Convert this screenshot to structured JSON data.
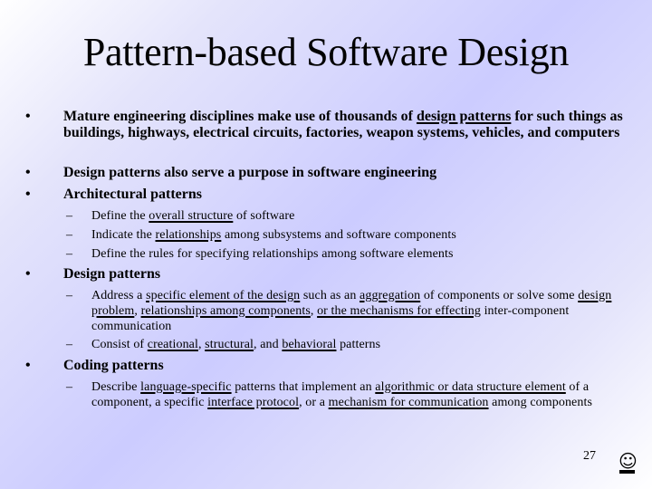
{
  "slide": {
    "title": "Pattern-based Software Design",
    "page_number": "27",
    "footer_icon": "smiley-face-icon",
    "colors": {
      "background_mid": "#ccccff",
      "background_edge": "#ffffff",
      "text": "#000000"
    }
  },
  "bullets": [
    {
      "marker": "•",
      "parts": [
        {
          "text": "Mature engineering disciplines make use of thousands of "
        },
        {
          "text": "design patterns",
          "underline": true
        },
        {
          "text": " for such things as buildings, highways, electrical circuits, factories, weapon systems, vehicles, and computers"
        }
      ]
    },
    {
      "marker": "•",
      "parts": [
        {
          "text": "Design patterns also serve a purpose in software engineering"
        }
      ]
    },
    {
      "marker": "•",
      "parts": [
        {
          "text": "Architectural patterns"
        }
      ],
      "sub": [
        {
          "marker": "–",
          "parts": [
            {
              "text": "Define the "
            },
            {
              "text": "overall structure",
              "underline": true
            },
            {
              "text": " of software"
            }
          ]
        },
        {
          "marker": "–",
          "parts": [
            {
              "text": "Indicate the "
            },
            {
              "text": "relationships",
              "underline": true
            },
            {
              "text": " among subsystems and software components"
            }
          ]
        },
        {
          "marker": "–",
          "parts": [
            {
              "text": "Define the rules for specifying relationships among software elements"
            }
          ]
        }
      ]
    },
    {
      "marker": "•",
      "parts": [
        {
          "text": "Design patterns"
        }
      ],
      "sub": [
        {
          "marker": "–",
          "parts": [
            {
              "text": "Address a "
            },
            {
              "text": "specific element of the design",
              "underline": true
            },
            {
              "text": " such as an "
            },
            {
              "text": "aggregation",
              "underline": true
            },
            {
              "text": " of components or solve some "
            },
            {
              "text": "design problem",
              "underline": true
            },
            {
              "text": ", "
            },
            {
              "text": "relationships among components",
              "underline": true
            },
            {
              "text": ", "
            },
            {
              "text": "or the mechanisms for effecting",
              "underline": true
            },
            {
              "text": " inter-component communication"
            }
          ]
        },
        {
          "marker": "–",
          "parts": [
            {
              "text": "Consist of "
            },
            {
              "text": "creational",
              "underline": true
            },
            {
              "text": ", "
            },
            {
              "text": "structural",
              "underline": true
            },
            {
              "text": ", and "
            },
            {
              "text": "behavioral",
              "underline": true
            },
            {
              "text": " patterns"
            }
          ]
        }
      ]
    },
    {
      "marker": "•",
      "parts": [
        {
          "text": "Coding patterns"
        }
      ],
      "sub": [
        {
          "marker": "–",
          "parts": [
            {
              "text": "Describe "
            },
            {
              "text": "language-specific",
              "underline": true
            },
            {
              "text": " patterns that implement an "
            },
            {
              "text": "algorithmic or data structure element",
              "underline": true
            },
            {
              "text": " of a component, a specific "
            },
            {
              "text": "interface protocol",
              "underline": true
            },
            {
              "text": ", or a "
            },
            {
              "text": "mechanism for communication",
              "underline": true
            },
            {
              "text": " among components"
            }
          ]
        }
      ]
    }
  ]
}
